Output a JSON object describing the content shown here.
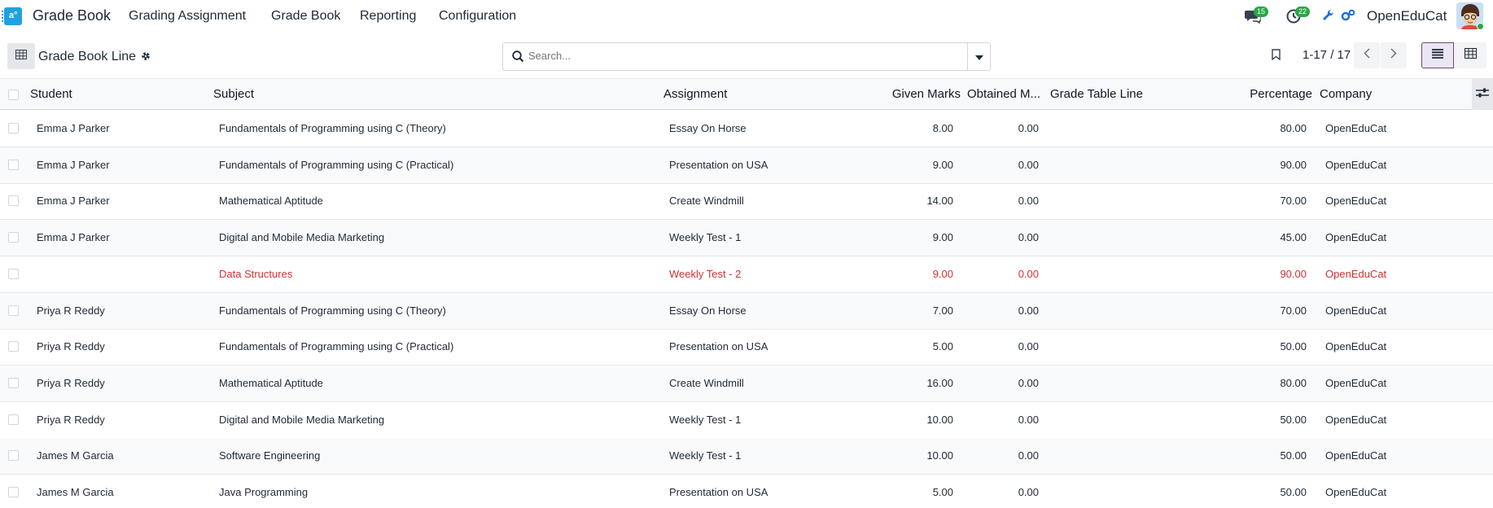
{
  "nav": {
    "brand": "Grade Book",
    "menu": [
      "Grading Assignment",
      "Grade Book",
      "Reporting",
      "Configuration"
    ],
    "messages_count": "15",
    "activities_count": "22",
    "company": "OpenEduCat"
  },
  "control": {
    "title": "Grade Book Line",
    "search_placeholder": "Search...",
    "pager": "1-17 / 17"
  },
  "table": {
    "headers": {
      "student": "Student",
      "subject": "Subject",
      "assignment": "Assignment",
      "given": "Given Marks",
      "obtained": "Obtained M...",
      "grade_line": "Grade Table Line",
      "percentage": "Percentage",
      "company": "Company"
    },
    "rows": [
      {
        "student": "Emma J Parker",
        "subject": "Fundamentals of Programming using C (Theory)",
        "assignment": "Essay On Horse",
        "given": "8.00",
        "obtained": "0.00",
        "grade_line": "",
        "percentage": "80.00",
        "company": "OpenEduCat"
      },
      {
        "student": "Emma J Parker",
        "subject": "Fundamentals of Programming using C (Practical)",
        "assignment": "Presentation on USA",
        "given": "9.00",
        "obtained": "0.00",
        "grade_line": "",
        "percentage": "90.00",
        "company": "OpenEduCat"
      },
      {
        "student": "Emma J Parker",
        "subject": "Mathematical Aptitude",
        "assignment": "Create Windmill",
        "given": "14.00",
        "obtained": "0.00",
        "grade_line": "",
        "percentage": "70.00",
        "company": "OpenEduCat"
      },
      {
        "student": "Emma J Parker",
        "subject": "Digital and Mobile Media Marketing",
        "assignment": "Weekly Test - 1",
        "given": "9.00",
        "obtained": "0.00",
        "grade_line": "",
        "percentage": "45.00",
        "company": "OpenEduCat"
      },
      {
        "student": "",
        "subject": "Data Structures",
        "assignment": "Weekly Test - 2",
        "given": "9.00",
        "obtained": "0.00",
        "grade_line": "",
        "percentage": "90.00",
        "company": "OpenEduCat"
      },
      {
        "student": "Priya R Reddy",
        "subject": "Fundamentals of Programming using C (Theory)",
        "assignment": "Essay On Horse",
        "given": "7.00",
        "obtained": "0.00",
        "grade_line": "",
        "percentage": "70.00",
        "company": "OpenEduCat"
      },
      {
        "student": "Priya R Reddy",
        "subject": "Fundamentals of Programming using C (Practical)",
        "assignment": "Presentation on USA",
        "given": "5.00",
        "obtained": "0.00",
        "grade_line": "",
        "percentage": "50.00",
        "company": "OpenEduCat"
      },
      {
        "student": "Priya R Reddy",
        "subject": "Mathematical Aptitude",
        "assignment": "Create Windmill",
        "given": "16.00",
        "obtained": "0.00",
        "grade_line": "",
        "percentage": "80.00",
        "company": "OpenEduCat"
      },
      {
        "student": "Priya R Reddy",
        "subject": "Digital and Mobile Media Marketing",
        "assignment": "Weekly Test - 1",
        "given": "10.00",
        "obtained": "0.00",
        "grade_line": "",
        "percentage": "50.00",
        "company": "OpenEduCat"
      },
      {
        "student": "James M Garcia",
        "subject": "Software Engineering",
        "assignment": "Weekly Test - 1",
        "given": "10.00",
        "obtained": "0.00",
        "grade_line": "",
        "percentage": "50.00",
        "company": "OpenEduCat"
      },
      {
        "student": "James M Garcia",
        "subject": "Java Programming",
        "assignment": "Presentation on USA",
        "given": "5.00",
        "obtained": "0.00",
        "grade_line": "",
        "percentage": "50.00",
        "company": "OpenEduCat"
      }
    ]
  },
  "colors": {
    "accent": "#714b67",
    "danger": "#d63031",
    "badge": "#28a745",
    "app_icon": "#1fa2e0"
  },
  "icons": [
    "app-icon",
    "chat-icon",
    "clock-icon",
    "wrench-icon",
    "settings-icon",
    "table-icon",
    "gear-icon",
    "search-icon",
    "caret-down-icon",
    "bookmark-icon",
    "chevron-left-icon",
    "chevron-right-icon",
    "list-view-icon",
    "pivot-view-icon",
    "optional-columns-icon"
  ]
}
